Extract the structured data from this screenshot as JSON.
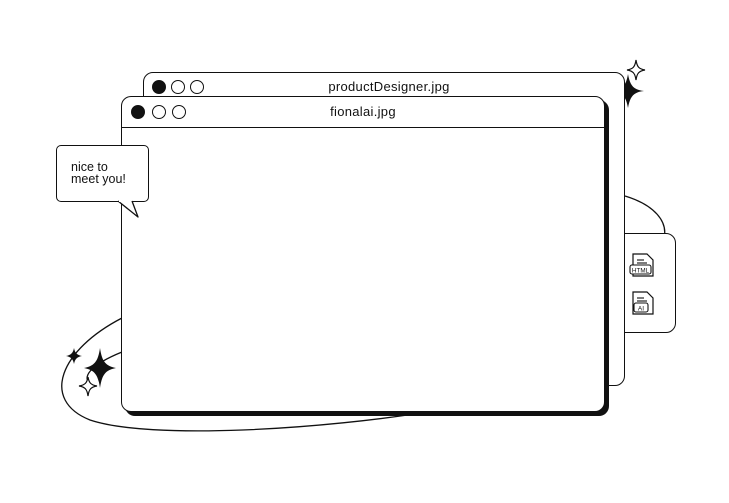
{
  "windows": {
    "back": {
      "title": "productDesigner.jpg"
    },
    "front": {
      "title": "fionalai.jpg"
    }
  },
  "speech_bubble": {
    "line1": "nice to",
    "line2": "meet you!"
  },
  "file_icons": [
    {
      "name": "file-icon",
      "label": ""
    },
    {
      "name": "html-file-icon",
      "label": "HTML"
    },
    {
      "name": "file-icon",
      "label": ""
    },
    {
      "name": "ai-file-icon",
      "label": "AI"
    }
  ],
  "colors": {
    "stroke": "#111111",
    "background": "#ffffff"
  }
}
